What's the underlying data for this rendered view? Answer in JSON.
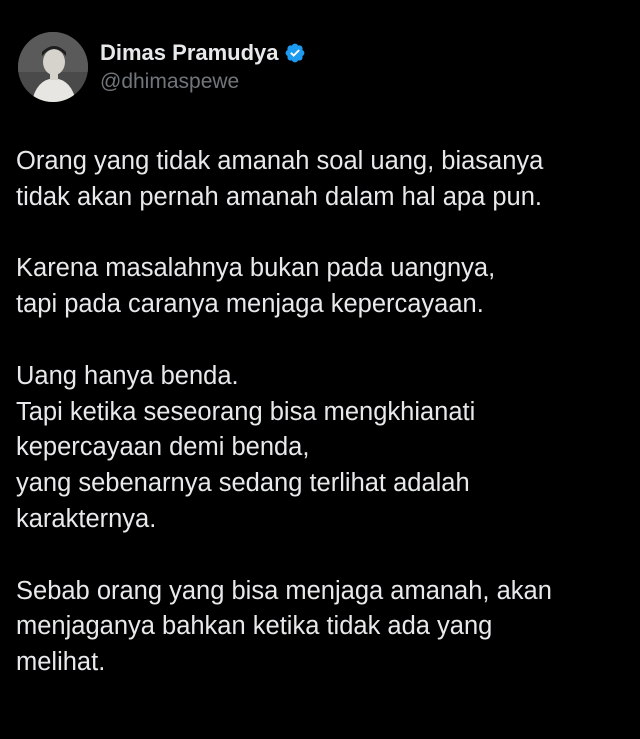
{
  "user": {
    "display_name": "Dimas Pramudya",
    "handle": "@dhimaspewe",
    "verified_icon": "verified-badge-icon",
    "verified_color": "#1d9bf0"
  },
  "tweet": {
    "paragraphs": [
      {
        "lines": [
          "Orang yang tidak amanah soal uang, biasanya",
          "tidak akan pernah amanah dalam hal apa pun."
        ]
      },
      {
        "lines": [
          "Karena masalahnya bukan pada uangnya,",
          "tapi pada caranya menjaga kepercayaan."
        ]
      },
      {
        "lines": [
          "Uang hanya benda.",
          "Tapi ketika seseorang bisa mengkhianati",
          "kepercayaan demi benda,",
          "yang sebenarnya sedang terlihat adalah",
          "karakternya."
        ]
      },
      {
        "lines": [
          "Sebab orang yang bisa menjaga amanah, akan",
          "menjaganya bahkan ketika tidak ada yang",
          "melihat."
        ]
      }
    ]
  },
  "colors": {
    "background": "#000000",
    "text": "#e7e9ea",
    "secondary_text": "#71767b"
  }
}
